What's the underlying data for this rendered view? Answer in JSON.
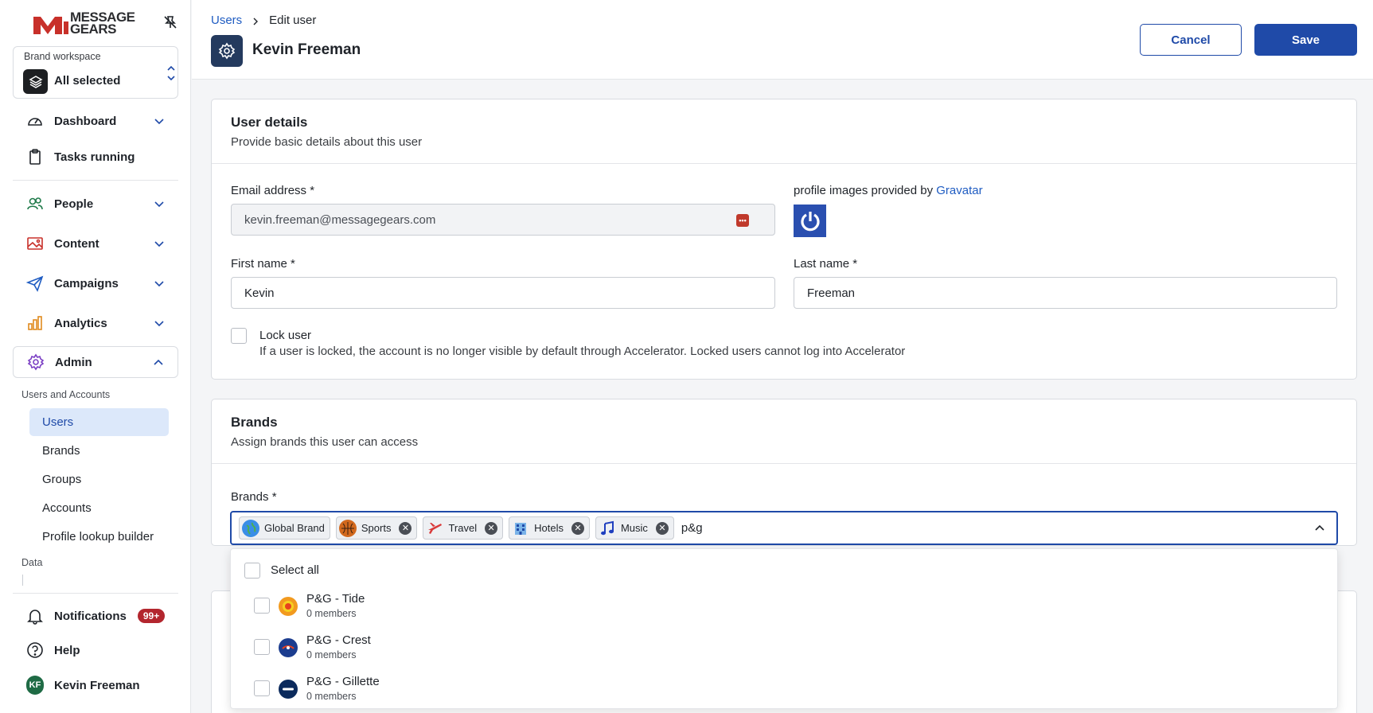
{
  "sidebar": {
    "logo_text_1": "MESSAGE",
    "logo_text_2": "GEARS",
    "workspace": {
      "label": "Brand workspace",
      "value": "All selected"
    },
    "nav": {
      "dashboard": "Dashboard",
      "tasks": "Tasks running",
      "people": "People",
      "content": "Content",
      "campaigns": "Campaigns",
      "analytics": "Analytics",
      "admin": "Admin"
    },
    "admin_group_label": "Users and Accounts",
    "admin_items": [
      "Users",
      "Brands",
      "Groups",
      "Accounts",
      "Profile lookup builder"
    ],
    "data_label": "Data",
    "notifications": {
      "label": "Notifications",
      "badge": "99+"
    },
    "help": "Help",
    "user": {
      "initials": "KF",
      "name": "Kevin Freeman"
    }
  },
  "header": {
    "breadcrumb_link": "Users",
    "breadcrumb_current": "Edit user",
    "title": "Kevin Freeman",
    "cancel": "Cancel",
    "save": "Save"
  },
  "user_details": {
    "title": "User details",
    "subtitle": "Provide basic details about this user",
    "email_label": "Email address *",
    "email_value": "kevin.freeman@messagegears.com",
    "gravatar_prefix": "profile images provided by ",
    "gravatar_link": "Gravatar",
    "first_name_label": "First name *",
    "first_name_value": "Kevin",
    "last_name_label": "Last name *",
    "last_name_value": "Freeman",
    "lock_label": "Lock user",
    "lock_help": "If a user is locked, the account is no longer visible by default through Accelerator. Locked users cannot log into Accelerator"
  },
  "brands": {
    "title": "Brands",
    "subtitle": "Assign brands this user can access",
    "field_label": "Brands *",
    "chips": [
      {
        "label": "Global Brand",
        "icon": "globe-icon",
        "removable": false
      },
      {
        "label": "Sports",
        "icon": "basketball-icon",
        "removable": true
      },
      {
        "label": "Travel",
        "icon": "airplane-icon",
        "removable": true
      },
      {
        "label": "Hotels",
        "icon": "hotel-icon",
        "removable": true
      },
      {
        "label": "Music",
        "icon": "music-note-icon",
        "removable": true
      }
    ],
    "search_text": "p&g",
    "dropdown": {
      "select_all": "Select all",
      "options": [
        {
          "name": "P&G - Tide",
          "members": "0 members",
          "logo_color": "#f29a1f"
        },
        {
          "name": "P&G - Crest",
          "members": "0 members",
          "logo_color": "#1c3d8f"
        },
        {
          "name": "P&G - Gillette",
          "members": "0 members",
          "logo_color": "#0b2a5c"
        }
      ]
    }
  },
  "colors": {
    "primary": "#1f4aa8",
    "brand_red": "#c8302a",
    "badge_red": "#b3262e"
  }
}
